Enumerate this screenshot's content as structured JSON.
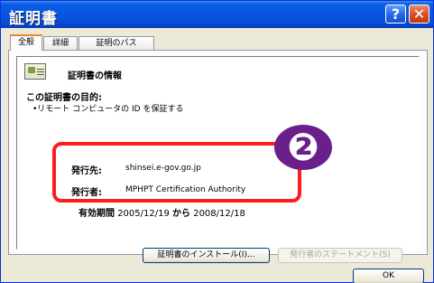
{
  "window": {
    "title": "証明書"
  },
  "titlebar": {
    "help_glyph": "?",
    "close_glyph": "✕"
  },
  "tabs": [
    {
      "label": "全般",
      "active": true
    },
    {
      "label": "詳細",
      "active": false
    },
    {
      "label": "証明のパス",
      "active": false
    }
  ],
  "cert": {
    "heading": "証明書の情報",
    "purpose_label": "この証明書の目的:",
    "purpose_items": [
      "•リモート コンピュータの ID を保証する"
    ],
    "issued_to_label": "発行先:",
    "issued_to_value": "shinsei.e-gov.go.jp",
    "issued_by_label": "発行者:",
    "issued_by_value": "MPHPT Certification Authority",
    "validity_label": "有効期間",
    "valid_from": "2005/12/19",
    "validity_mid": "から",
    "valid_to": "2008/12/18"
  },
  "annotation": {
    "badge": "❷",
    "highlight_color": "#ff1c1c",
    "badge_color": "#6a1f8a"
  },
  "buttons": {
    "install": "証明書のインストール(I)...",
    "statement": "発行者のステートメント(S)",
    "ok": "OK"
  },
  "colors": {
    "titlebar": "#0a55e0",
    "dialog_bg": "#ece9d8"
  },
  "icons": {
    "cert_icon": "certificate-icon",
    "help": "help-icon",
    "close": "close-icon"
  }
}
